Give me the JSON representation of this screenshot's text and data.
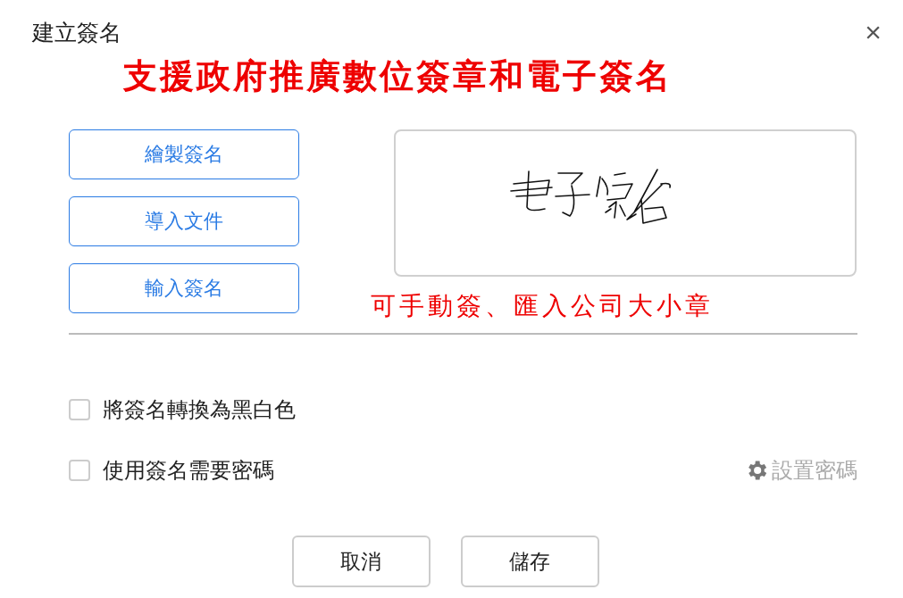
{
  "dialog": {
    "title": "建立簽名",
    "close": "×"
  },
  "annotations": [
    "支援政府推廣數位簽章和電子簽名",
    "可手動簽、匯入公司大小章"
  ],
  "sources": [
    {
      "label": "繪製簽名"
    },
    {
      "label": "導入文件"
    },
    {
      "label": "輸入簽名"
    }
  ],
  "options": [
    {
      "label": "將簽名轉換為黑白色",
      "checked": false
    },
    {
      "label": "使用簽名需要密碼",
      "checked": false
    }
  ],
  "set_password": {
    "label": "設置密碼",
    "disabled": true
  },
  "buttons": [
    "取消",
    "儲存"
  ]
}
